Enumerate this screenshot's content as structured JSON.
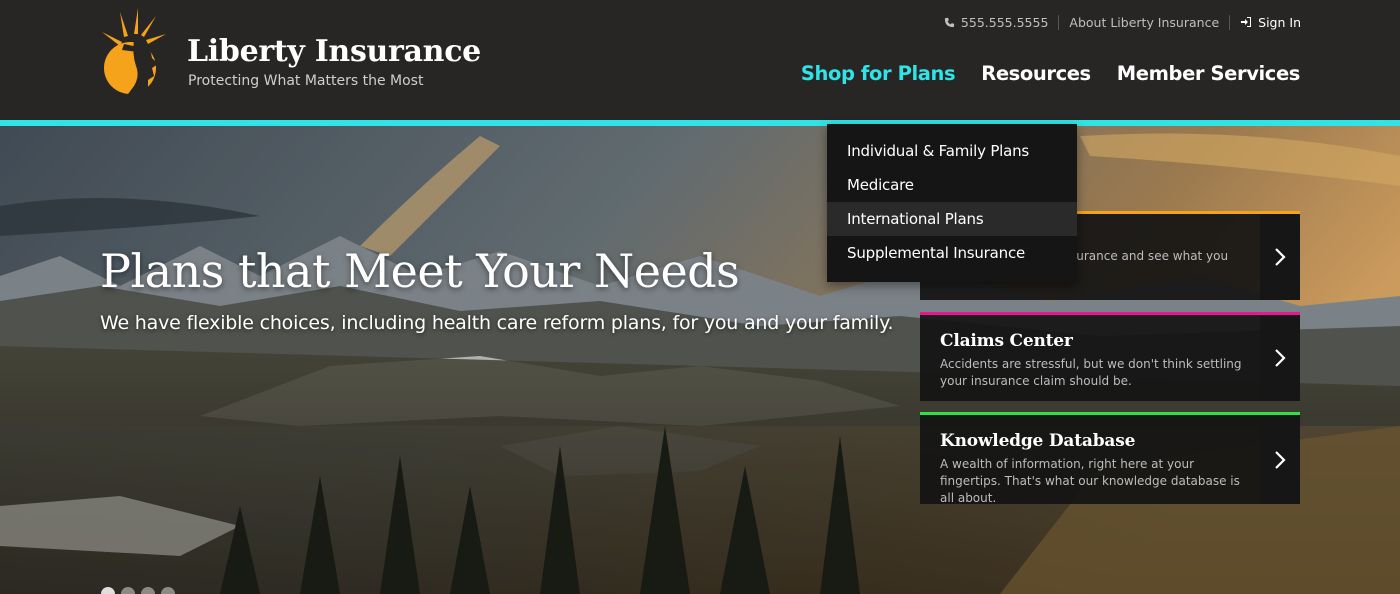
{
  "brand": {
    "title": "Liberty Insurance",
    "tagline": "Protecting What Matters the Most",
    "logo_icon": "liberty-statue-logo",
    "accent_color": "#2fe3e6"
  },
  "utility_nav": {
    "phone": "555.555.5555",
    "about": "About Liberty Insurance",
    "sign_in": "Sign In"
  },
  "main_nav": [
    {
      "label": "Shop for Plans",
      "active": true
    },
    {
      "label": "Resources",
      "active": false
    },
    {
      "label": "Member Services",
      "active": false
    }
  ],
  "dropdown": {
    "items": [
      {
        "label": "Individual & Family Plans"
      },
      {
        "label": "Medicare"
      },
      {
        "label": "International Plans",
        "hover": true
      },
      {
        "label": "Supplemental Insurance"
      }
    ]
  },
  "hero": {
    "title": "Plans that Meet Your Needs",
    "subtitle": "We have flexible choices, including health care reform plans, for you and your family."
  },
  "cards": [
    {
      "title": "",
      "description": "surance and see what you",
      "accent": "#f5a31a"
    },
    {
      "title": "Claims Center",
      "description": "Accidents are stressful, but we don't think settling your insurance claim should be.",
      "accent": "#e6178f"
    },
    {
      "title": "Knowledge Database",
      "description": "A wealth of information, right here at your fingertips. That's what our knowledge database is all about.",
      "accent": "#2ee04a"
    }
  ],
  "slider": {
    "count": 4,
    "active_index": 0
  }
}
